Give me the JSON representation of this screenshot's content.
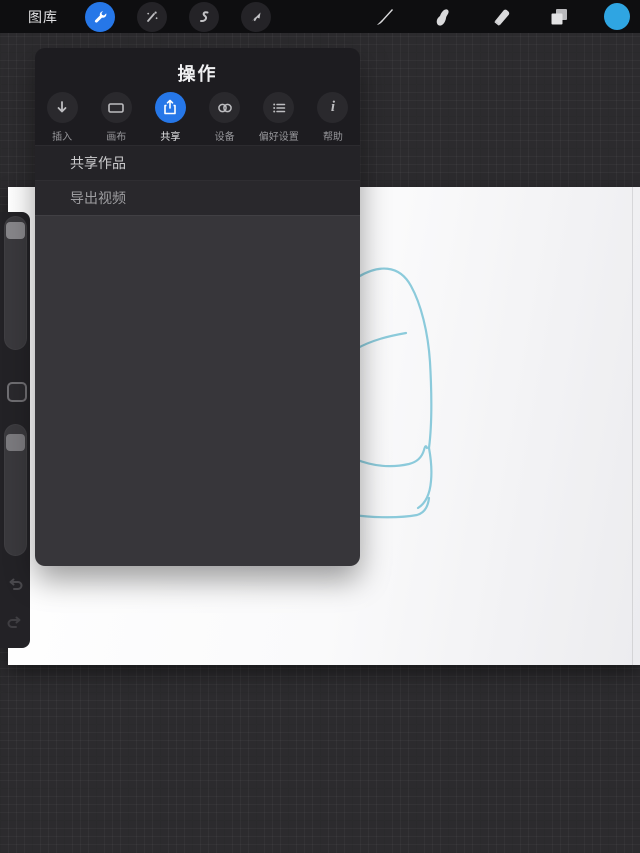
{
  "topbar": {
    "gallery_label": "图库",
    "tools_left": [
      {
        "name": "actions-wrench",
        "icon": "wrench-icon",
        "active": true
      },
      {
        "name": "adjustments-wand",
        "icon": "magic-wand-icon",
        "active": false
      },
      {
        "name": "selection-s",
        "icon": "s-curve-icon",
        "active": false
      },
      {
        "name": "transform-arrow",
        "icon": "cursor-arrow-icon",
        "active": false
      }
    ],
    "tools_right": [
      {
        "name": "brush-tool",
        "icon": "paintbrush-icon"
      },
      {
        "name": "smudge-tool",
        "icon": "smudge-finger-icon"
      },
      {
        "name": "eraser-tool",
        "icon": "eraser-icon"
      },
      {
        "name": "layers-panel",
        "icon": "layers-icon"
      },
      {
        "name": "color-panel",
        "icon": "color-circle-icon"
      }
    ]
  },
  "popover": {
    "title": "操作",
    "tabs": [
      {
        "label": "插入",
        "icon": "arrow-down-icon",
        "active": false
      },
      {
        "label": "画布",
        "icon": "canvas-rect-icon",
        "active": false
      },
      {
        "label": "共享",
        "icon": "share-icon",
        "active": true
      },
      {
        "label": "设备",
        "icon": "link-rings-icon",
        "active": false
      },
      {
        "label": "偏好设置",
        "icon": "list-icon",
        "active": false
      },
      {
        "label": "帮助",
        "icon": "info-i-icon",
        "active": false
      }
    ],
    "menu_items": [
      "共享作品",
      "导出视频"
    ]
  },
  "colors": {
    "accent_blue": "#2677e8",
    "color_swatch_blue": "#2fa5e2",
    "sketch_stroke": "#79c3d6",
    "canvas_white": "#fafafb",
    "background_gray": "#2c2b2e"
  }
}
